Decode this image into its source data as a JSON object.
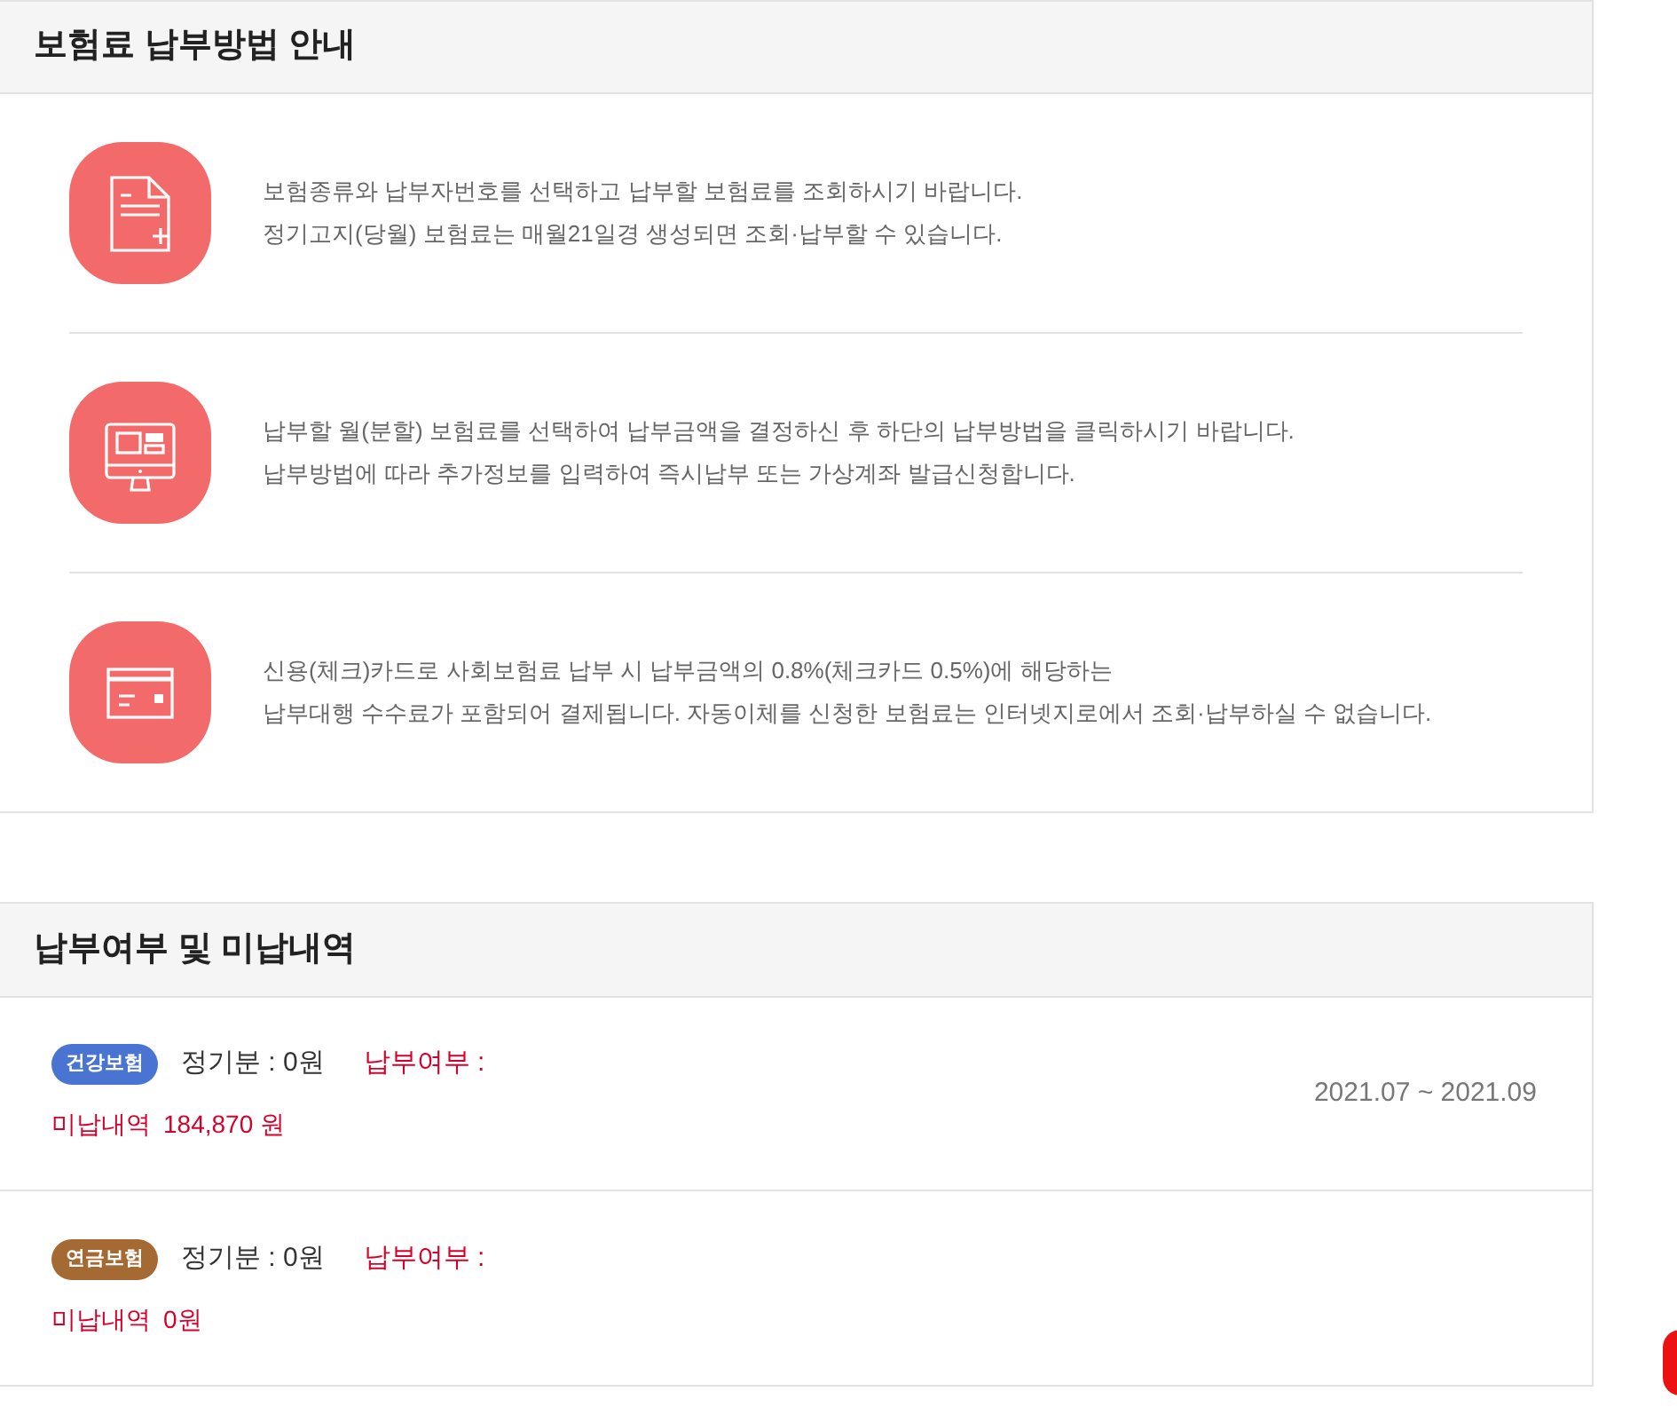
{
  "guide": {
    "title": "보험료 납부방법 안내",
    "steps": [
      {
        "kind": "document",
        "lines": [
          "보험종류와 납부자번호를 선택하고 납부할 보험료를 조회하시기 바랍니다.",
          "정기고지(당월) 보험료는 매월21일경 생성되면 조회·납부할 수 있습니다."
        ]
      },
      {
        "kind": "monitor",
        "lines": [
          "납부할 월(분할) 보험료를 선택하여 납부금액을 결정하신 후 하단의 납부방법을 클릭하시기 바랍니다.",
          "납부방법에 따라 추가정보를 입력하여 즉시납부 또는 가상계좌 발급신청합니다."
        ]
      },
      {
        "kind": "card",
        "lines": [
          "신용(체크)카드로 사회보험료 납부 시 납부금액의 0.8%(체크카드 0.5%)에 해당하는",
          "납부대행 수수료가 포함되어 결제됩니다. 자동이체를 신청한 보험료는 인터넷지로에서 조회·납부하실 수 없습니다."
        ]
      }
    ]
  },
  "payment_status": {
    "title": "납부여부 및 미납내역",
    "items": [
      {
        "badge": {
          "label": "건강보험",
          "color": "#4a74d2"
        },
        "regular": "정기분 : 0원",
        "paid_label": "납부여부 :",
        "period": "2021.07 ~ 2021.09",
        "unpaid_label": "미납내역",
        "unpaid_amount": "184,870 원"
      },
      {
        "badge": {
          "label": "연금보험",
          "color": "#a56a33"
        },
        "regular": "정기분 : 0원",
        "paid_label": "납부여부 :",
        "unpaid_label": "미납내역",
        "unpaid_amount": "0원"
      }
    ]
  }
}
